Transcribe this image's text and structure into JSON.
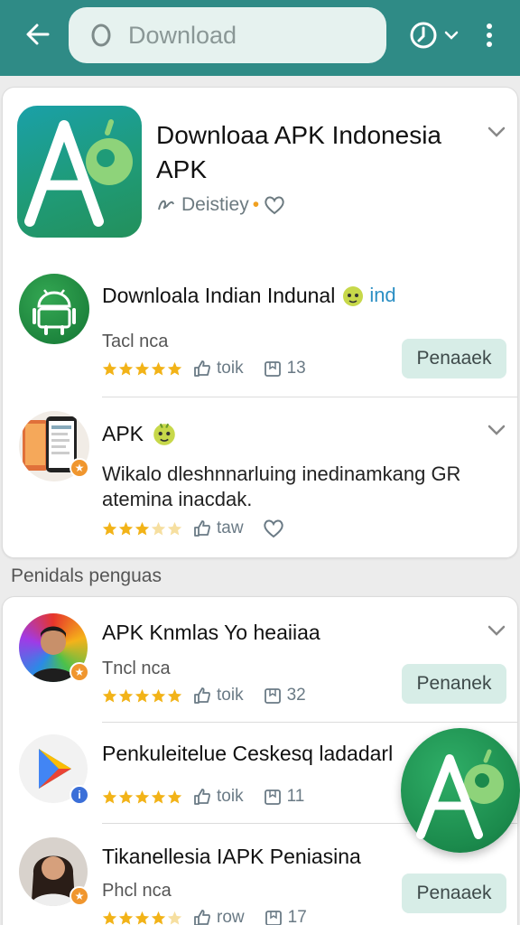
{
  "search": {
    "placeholder": "Download"
  },
  "featured": {
    "title": "Downloaa APK Indonesia APK",
    "developer": "Deistiey"
  },
  "apps": [
    {
      "name": "Downloala Indian Indunal",
      "tag": "ind",
      "sub": "Tacl nca",
      "rating_stars": 5,
      "downloads": "toik",
      "count": "13",
      "button": "Penaaek"
    },
    {
      "name": "APK",
      "description": "Wikalo dleshnnarluing inedinamkang GR atemina inacdak.",
      "rating_stars": 3,
      "downloads": "taw"
    }
  ],
  "section_label": "Penidals penguas",
  "more_apps": [
    {
      "name": "APK Knmlas Yo heaiiaa",
      "sub": "Tncl nca",
      "rating_stars": 5,
      "downloads": "toik",
      "count": "32",
      "button": "Penanek"
    },
    {
      "name": "Penkuleitelue Ceskesq ladadarl",
      "rating_stars": 5,
      "downloads": "toik",
      "count": "11"
    },
    {
      "name": "Tikanellesia IAPK Peniasina",
      "sub": "Phcl nca",
      "rating_stars": 4,
      "downloads": "row",
      "count": "17",
      "button": "Penaaek"
    }
  ],
  "colors": {
    "appbar": "#2f8b86",
    "search_bg": "#e6f2ef",
    "star": "#f2b318",
    "button_bg": "#d7ede7",
    "brand_green": "#1b8a4c"
  },
  "icons": {
    "back": "arrow-left-icon",
    "search": "search-icon",
    "history": "history-icon",
    "more": "more-vertical-icon"
  }
}
